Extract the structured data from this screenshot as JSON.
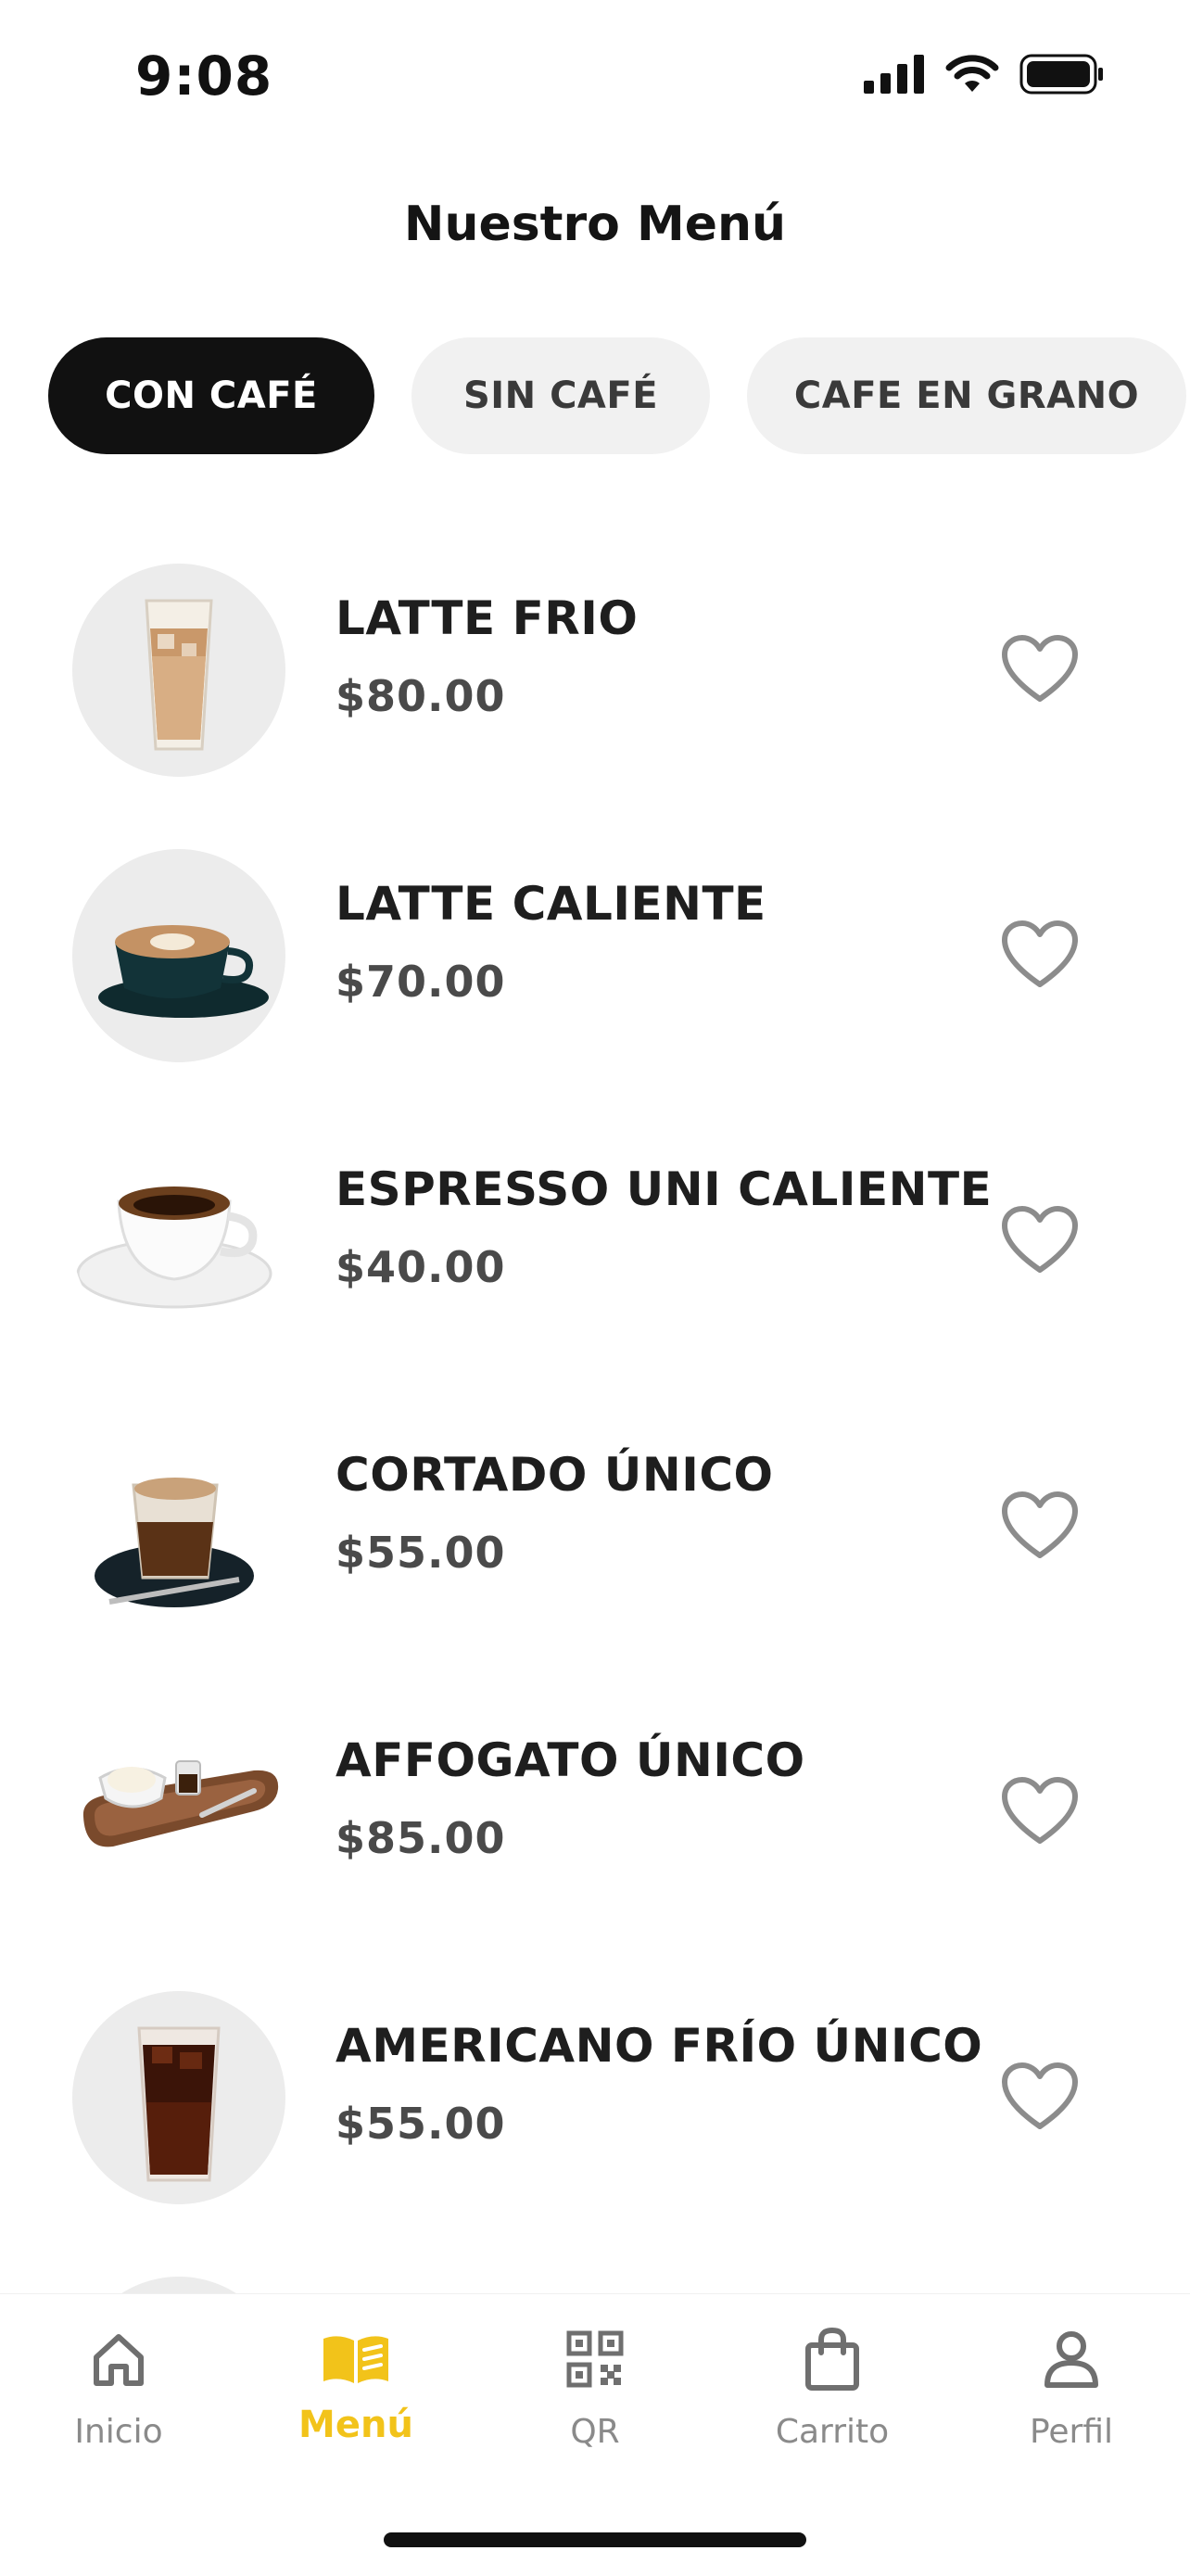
{
  "status_bar": {
    "time": "9:08"
  },
  "header": {
    "title": "Nuestro Menú"
  },
  "categories": [
    {
      "label": "CON CAFÉ",
      "active": true
    },
    {
      "label": "SIN CAFÉ",
      "active": false
    },
    {
      "label": "CAFE EN GRANO",
      "active": false
    }
  ],
  "menu_items": [
    {
      "name": "LATTE FRIO",
      "price": "$80.00",
      "icon": "iced-latte"
    },
    {
      "name": "LATTE CALIENTE",
      "price": "$70.00",
      "icon": "hot-latte-cup"
    },
    {
      "name": "ESPRESSO UNI CALIENTE",
      "price": "$40.00",
      "icon": "espresso-cup"
    },
    {
      "name": "CORTADO ÚNICO",
      "price": "$55.00",
      "icon": "cortado-glass"
    },
    {
      "name": "AFFOGATO ÚNICO",
      "price": "$85.00",
      "icon": "affogato-tray"
    },
    {
      "name": "AMERICANO FRÍO ÚNICO",
      "price": "$55.00",
      "icon": "iced-americano"
    }
  ],
  "tabbar": {
    "items": [
      {
        "label": "Inicio",
        "icon": "home-icon",
        "active": false
      },
      {
        "label": "Menú",
        "icon": "book-icon",
        "active": true
      },
      {
        "label": "QR",
        "icon": "qr-icon",
        "active": false
      },
      {
        "label": "Carrito",
        "icon": "bag-icon",
        "active": false
      },
      {
        "label": "Perfil",
        "icon": "user-icon",
        "active": false
      }
    ]
  },
  "colors": {
    "accent": "#f2c31a",
    "chip_active": "#111111",
    "chip_inactive": "#f1f1f1",
    "heart": "#8c8c8c"
  }
}
